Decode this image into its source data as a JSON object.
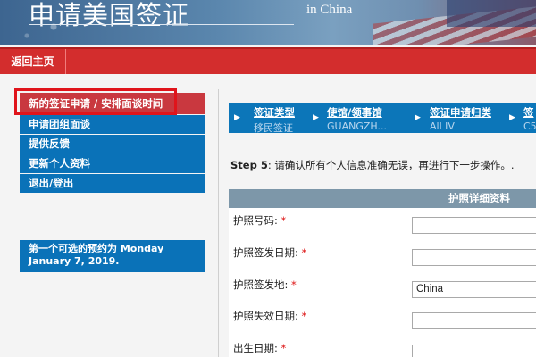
{
  "header": {
    "title": "申请美国签证",
    "subtitle": "in China"
  },
  "nav": {
    "home_label": "返回主页"
  },
  "sidebar": {
    "items": [
      {
        "label": "新的签证申请 / 安排面谈时间",
        "active": true
      },
      {
        "label": "申请团组面谈"
      },
      {
        "label": "提供反馈"
      },
      {
        "label": "更新个人资料"
      },
      {
        "label": "退出/登出"
      }
    ],
    "note": "第一个可选的预约为 Monday January 7, 2019."
  },
  "breadcrumbs": [
    {
      "title": "签证类型",
      "value": "移民签证"
    },
    {
      "title": "使馆/领事馆",
      "value": "GUANGZH..."
    },
    {
      "title": "签证申请归类",
      "value": "All IV"
    },
    {
      "title": "签",
      "value": "C5"
    }
  ],
  "step": {
    "label": "Step 5",
    "text": ": 请确认所有个人信息准确无误，再进行下一步操作。."
  },
  "section": {
    "title": "护照详细资料"
  },
  "form": {
    "fields": [
      {
        "label": "护照号码:",
        "value": ""
      },
      {
        "label": "护照签发日期:",
        "value": ""
      },
      {
        "label": "护照签发地:",
        "value": "China"
      },
      {
        "label": "护照失效日期:",
        "value": ""
      },
      {
        "label": "出生日期:",
        "value": ""
      }
    ],
    "required_mark": "*"
  },
  "colors": {
    "nav_red": "#d32d2d",
    "sidebar_blue": "#0a72b8",
    "active_red": "#c9383f",
    "section_gray": "#7d97a9"
  }
}
